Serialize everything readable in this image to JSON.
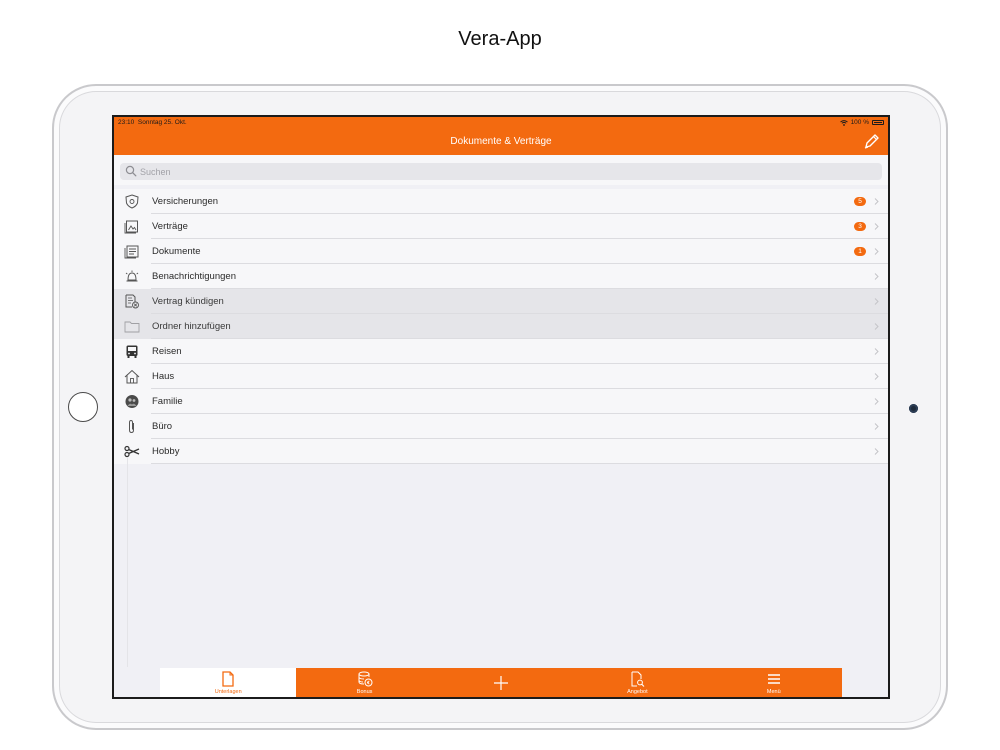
{
  "page": {
    "title": "Vera-App"
  },
  "status_bar": {
    "time": "23:10",
    "date": "Sonntag 25. Okt.",
    "battery": "100 %"
  },
  "nav": {
    "title": "Dokumente & Verträge",
    "edit_icon": "pencil-icon"
  },
  "search": {
    "placeholder": "Suchen",
    "value": ""
  },
  "list": {
    "items": [
      {
        "label": "Versicherungen",
        "icon": "shield-icon",
        "badge": "5"
      },
      {
        "label": "Verträge",
        "icon": "contract-icon",
        "badge": "3"
      },
      {
        "label": "Dokumente",
        "icon": "documents-icon",
        "badge": "1"
      },
      {
        "label": "Benachrichtigungen",
        "icon": "alarm-icon"
      },
      {
        "label": "Vertrag kündigen",
        "icon": "cancel-contract-icon"
      },
      {
        "label": "Ordner hinzufügen",
        "icon": "folder-icon"
      },
      {
        "label": "Reisen",
        "icon": "bus-icon"
      },
      {
        "label": "Haus",
        "icon": "house-icon"
      },
      {
        "label": "Familie",
        "icon": "family-icon"
      },
      {
        "label": "Büro",
        "icon": "paperclip-icon"
      },
      {
        "label": "Hobby",
        "icon": "scissors-icon"
      }
    ]
  },
  "tabs": [
    {
      "label": "Unterlagen",
      "icon": "document-icon",
      "active": true
    },
    {
      "label": "Bonus",
      "icon": "coins-icon"
    },
    {
      "label": "",
      "icon": "plus-icon"
    },
    {
      "label": "Angebot",
      "icon": "search-document-icon"
    },
    {
      "label": "Menü",
      "icon": "menu-icon"
    }
  ],
  "colors": {
    "accent": "#f36a10",
    "background": "#f0f0f5",
    "row_highlight": "#e5e5e9"
  }
}
